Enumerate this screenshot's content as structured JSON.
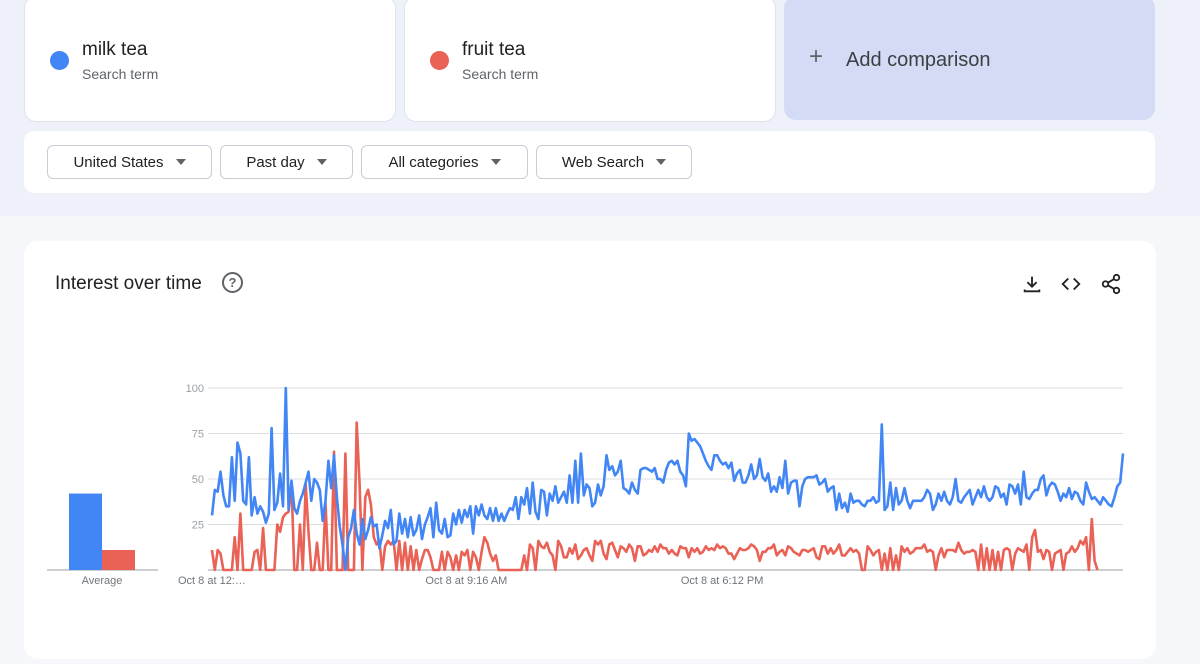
{
  "terms": [
    {
      "name": "milk tea",
      "subtitle": "Search term",
      "color": "#4285f4"
    },
    {
      "name": "fruit tea",
      "subtitle": "Search term",
      "color": "#ea6155"
    }
  ],
  "add_comparison": {
    "plus": "+",
    "label": "Add comparison"
  },
  "filters": [
    {
      "label": "United States"
    },
    {
      "label": "Past day"
    },
    {
      "label": "All categories"
    },
    {
      "label": "Web Search"
    }
  ],
  "interest": {
    "title": "Interest over time",
    "help": "?",
    "icons": [
      "download-icon",
      "embed-icon",
      "share-icon"
    ]
  },
  "chart_data": {
    "type": "line",
    "ylim": [
      0,
      100
    ],
    "yticks": [
      25,
      50,
      75,
      100
    ],
    "x_tick_labels": [
      {
        "label": "Oct 8 at 12:…",
        "index": 0
      },
      {
        "label": "Oct 8 at 9:16 AM",
        "index": 90
      },
      {
        "label": "Oct 8 at 6:12 PM",
        "index": 180
      }
    ],
    "average": {
      "label": "Average",
      "values": [
        {
          "series": "milk tea",
          "value": 42
        },
        {
          "series": "fruit tea",
          "value": 11
        }
      ]
    },
    "series": [
      {
        "name": "milk tea",
        "color": "#4285f4",
        "values": [
          30,
          44,
          43,
          54,
          41,
          35,
          35,
          62,
          38,
          70,
          64,
          38,
          36,
          62,
          30,
          40,
          31,
          35,
          32,
          26,
          31,
          78,
          33,
          37,
          53,
          35,
          100,
          33,
          49,
          34,
          31,
          38,
          42,
          48,
          54,
          38,
          50,
          48,
          44,
          27,
          38,
          60,
          45,
          63,
          40,
          24,
          14,
          0,
          18,
          23,
          33,
          20,
          14,
          28,
          17,
          22,
          29,
          24,
          25,
          12,
          19,
          27,
          23,
          33,
          14,
          16,
          31,
          20,
          28,
          18,
          29,
          19,
          22,
          30,
          17,
          25,
          29,
          34,
          18,
          37,
          22,
          20,
          28,
          18,
          19,
          31,
          25,
          33,
          26,
          33,
          29,
          35,
          20,
          35,
          30,
          36,
          30,
          28,
          34,
          27,
          34,
          27,
          31,
          27,
          31,
          34,
          33,
          40,
          28,
          40,
          36,
          45,
          31,
          48,
          32,
          28,
          44,
          43,
          30,
          42,
          38,
          46,
          37,
          40,
          43,
          37,
          52,
          37,
          60,
          37,
          64,
          41,
          47,
          45,
          35,
          37,
          47,
          41,
          46,
          63,
          55,
          57,
          52,
          54,
          60,
          45,
          44,
          42,
          48,
          44,
          42,
          55,
          56,
          56,
          55,
          54,
          56,
          50,
          50,
          48,
          55,
          59,
          60,
          58,
          60,
          54,
          52,
          46,
          75,
          71,
          72,
          70,
          68,
          64,
          60,
          57,
          55,
          63,
          63,
          60,
          58,
          59,
          56,
          59,
          49,
          53,
          55,
          48,
          48,
          52,
          58,
          50,
          52,
          61,
          51,
          49,
          53,
          43,
          46,
          43,
          51,
          45,
          60,
          42,
          48,
          49,
          49,
          35,
          46,
          50,
          51,
          51,
          51,
          52,
          47,
          48,
          50,
          43,
          45,
          46,
          33,
          42,
          34,
          37,
          32,
          42,
          37,
          38,
          38,
          36,
          35,
          38,
          38,
          40,
          37,
          38,
          80,
          33,
          35,
          48,
          33,
          45,
          36,
          38,
          45,
          38,
          34,
          38,
          38,
          38,
          38,
          40,
          44,
          42,
          33,
          36,
          42,
          38,
          43,
          38,
          36,
          40,
          50,
          38,
          37,
          40,
          42,
          44,
          36,
          40,
          44,
          40,
          46,
          40,
          38,
          40,
          46,
          45,
          40,
          42,
          36,
          47,
          46,
          42,
          47,
          36,
          54,
          40,
          39,
          42,
          44,
          44,
          50,
          52,
          41,
          46,
          48,
          47,
          43,
          38,
          42,
          40,
          45,
          39,
          43,
          42,
          38,
          36,
          48,
          43,
          39,
          40,
          38,
          36,
          40,
          38,
          36,
          35,
          40,
          46,
          48,
          64
        ],
        "note_values": []
      },
      {
        "name": "fruit tea",
        "color": "#ea6155",
        "values": [
          11,
          0,
          11,
          9,
          0,
          0,
          0,
          0,
          18,
          0,
          31,
          0,
          0,
          0,
          0,
          10,
          11,
          0,
          23,
          0,
          0,
          0,
          0,
          25,
          21,
          29,
          31,
          32,
          48,
          0,
          0,
          25,
          0,
          47,
          21,
          0,
          0,
          15,
          0,
          0,
          37,
          0,
          0,
          65,
          0,
          0,
          0,
          64,
          0,
          0,
          0,
          81,
          47,
          0,
          40,
          44,
          36,
          18,
          14,
          16,
          0,
          13,
          16,
          14,
          16,
          0,
          16,
          0,
          15,
          0,
          13,
          0,
          11,
          0,
          6,
          11,
          11,
          7,
          0,
          0,
          0,
          10,
          0,
          10,
          7,
          0,
          8,
          0,
          10,
          8,
          11,
          0,
          10,
          7,
          0,
          10,
          18,
          15,
          9,
          5,
          8,
          0,
          0,
          0,
          0,
          0,
          0,
          0,
          0,
          0,
          8,
          0,
          14,
          12,
          0,
          16,
          13,
          12,
          15,
          10,
          8,
          0,
          16,
          13,
          7,
          7,
          12,
          9,
          14,
          6,
          8,
          11,
          12,
          8,
          5,
          16,
          14,
          16,
          9,
          6,
          14,
          15,
          11,
          7,
          13,
          12,
          10,
          14,
          12,
          5,
          13,
          13,
          8,
          9,
          11,
          10,
          13,
          10,
          14,
          12,
          12,
          9,
          11,
          9,
          8,
          13,
          12,
          12,
          7,
          12,
          10,
          12,
          9,
          10,
          13,
          11,
          12,
          11,
          14,
          12,
          13,
          12,
          9,
          9,
          6,
          9,
          12,
          11,
          11,
          12,
          14,
          13,
          11,
          5,
          10,
          10,
          12,
          12,
          14,
          8,
          10,
          11,
          8,
          13,
          12,
          10,
          9,
          8,
          11,
          11,
          10,
          11,
          12,
          7,
          6,
          13,
          13,
          9,
          12,
          9,
          11,
          14,
          8,
          8,
          10,
          12,
          10,
          11,
          9,
          0,
          0,
          13,
          11,
          8,
          10,
          11,
          0,
          9,
          0,
          12,
          0,
          8,
          0,
          13,
          10,
          12,
          9,
          10,
          12,
          12,
          12,
          14,
          10,
          11,
          10,
          0,
          8,
          12,
          7,
          11,
          11,
          11,
          10,
          15,
          11,
          9,
          10,
          10,
          11,
          10,
          0,
          14,
          0,
          12,
          0,
          11,
          0,
          10,
          0,
          11,
          12,
          11,
          0,
          9,
          12,
          11,
          10,
          14,
          0,
          18,
          22,
          10,
          11,
          6,
          11,
          10,
          0,
          9,
          10,
          11,
          0,
          9,
          10,
          13,
          10,
          12,
          16,
          14,
          18,
          0,
          28,
          5,
          0
        ],
        "note_values": []
      }
    ]
  }
}
